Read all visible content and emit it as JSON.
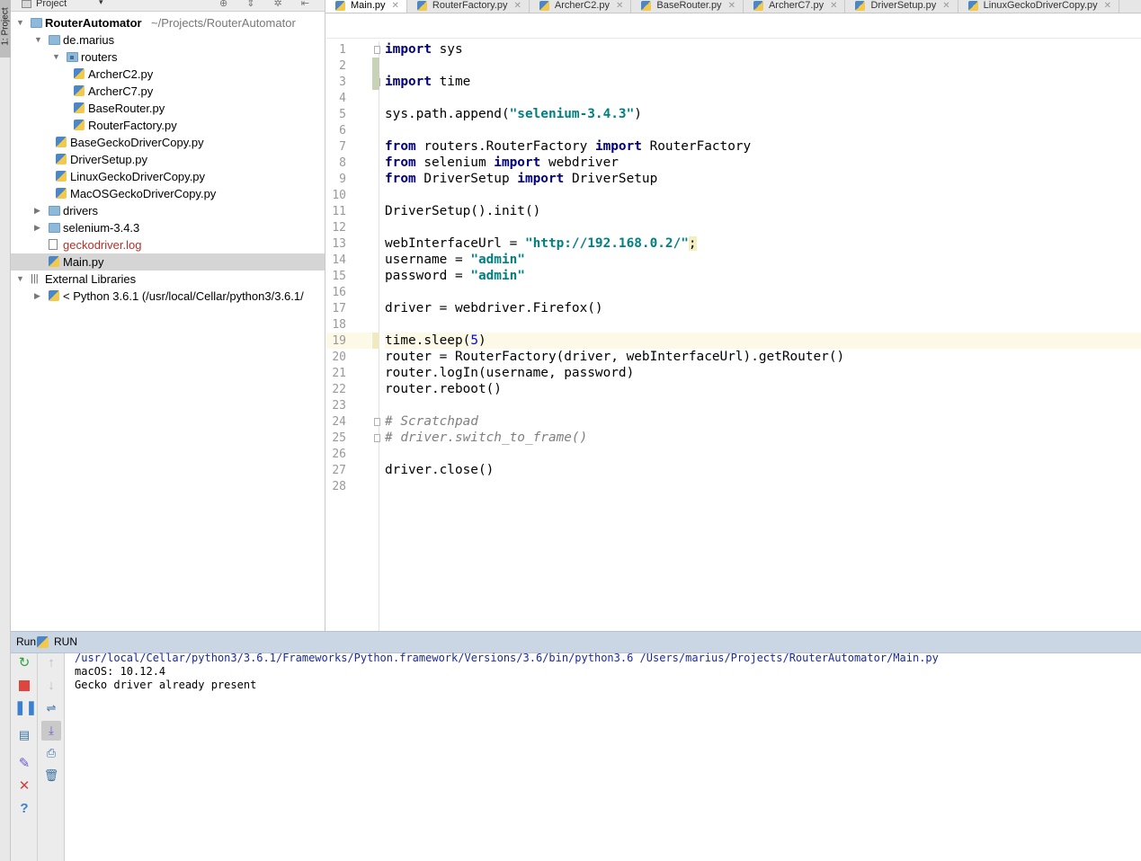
{
  "sidebar": {
    "strip_tab": "1: Project",
    "panel_title": "Project",
    "panel_dropdown": "▾",
    "tools": "⊕ ⇕ ✲ ⇤"
  },
  "tree": [
    {
      "label": "RouterAutomator",
      "path": "~/Projects/RouterAutomator",
      "depth": 0,
      "type": "root",
      "expanded": true
    },
    {
      "label": "de.marius",
      "depth": 1,
      "type": "folder",
      "expanded": true
    },
    {
      "label": "routers",
      "depth": 2,
      "type": "package",
      "expanded": true
    },
    {
      "label": "ArcherC2.py",
      "depth": 3,
      "type": "py"
    },
    {
      "label": "ArcherC7.py",
      "depth": 3,
      "type": "py"
    },
    {
      "label": "BaseRouter.py",
      "depth": 3,
      "type": "py"
    },
    {
      "label": "RouterFactory.py",
      "depth": 3,
      "type": "py"
    },
    {
      "label": "BaseGeckoDriverCopy.py",
      "depth": 2,
      "type": "py"
    },
    {
      "label": "DriverSetup.py",
      "depth": 2,
      "type": "py"
    },
    {
      "label": "LinuxGeckoDriverCopy.py",
      "depth": 2,
      "type": "py"
    },
    {
      "label": "MacOSGeckoDriverCopy.py",
      "depth": 2,
      "type": "py"
    },
    {
      "label": "drivers",
      "depth": 1,
      "type": "folder",
      "expanded": false
    },
    {
      "label": "selenium-3.4.3",
      "depth": 1,
      "type": "folder",
      "expanded": false
    },
    {
      "label": "geckodriver.log",
      "depth": 1,
      "type": "log"
    },
    {
      "label": "Main.py",
      "depth": 1,
      "type": "py",
      "selected": true
    },
    {
      "label": "External Libraries",
      "depth": 0,
      "type": "lib",
      "expanded": true
    },
    {
      "label": "< Python 3.6.1 (/usr/local/Cellar/python3/3.6.1/",
      "depth": 1,
      "type": "pyenv",
      "expanded": false
    }
  ],
  "editor_tabs": [
    {
      "label": "Main.py",
      "active": true
    },
    {
      "label": "RouterFactory.py"
    },
    {
      "label": "ArcherC2.py"
    },
    {
      "label": "BaseRouter.py"
    },
    {
      "label": "ArcherC7.py"
    },
    {
      "label": "DriverSetup.py"
    },
    {
      "label": "LinuxGeckoDriverCopy.py"
    }
  ],
  "editor": {
    "current_line": 19,
    "lines": [
      [
        [
          "kw",
          "import"
        ],
        [
          "t",
          " sys"
        ]
      ],
      [],
      [
        [
          "kw",
          "import"
        ],
        [
          "t",
          " time"
        ]
      ],
      [],
      [
        [
          "t",
          "sys.path.append("
        ],
        [
          "str",
          "\"selenium-3.4.3\""
        ],
        [
          "t",
          ")"
        ]
      ],
      [],
      [
        [
          "kw",
          "from"
        ],
        [
          "t",
          " routers.RouterFactory "
        ],
        [
          "kw",
          "import"
        ],
        [
          "t",
          " RouterFactory"
        ]
      ],
      [
        [
          "kw",
          "from"
        ],
        [
          "t",
          " selenium "
        ],
        [
          "kw",
          "import"
        ],
        [
          "t",
          " webdriver"
        ]
      ],
      [
        [
          "kw",
          "from"
        ],
        [
          "t",
          " DriverSetup "
        ],
        [
          "kw",
          "import"
        ],
        [
          "t",
          " DriverSetup"
        ]
      ],
      [],
      [
        [
          "t",
          "DriverSetup().init()"
        ]
      ],
      [],
      [
        [
          "t",
          "webInterfaceUrl = "
        ],
        [
          "str",
          "\"http://192.168.0.2/\""
        ],
        [
          "semi",
          ";"
        ]
      ],
      [
        [
          "t",
          "username = "
        ],
        [
          "str",
          "\"admin\""
        ]
      ],
      [
        [
          "t",
          "password = "
        ],
        [
          "str",
          "\"admin\""
        ]
      ],
      [],
      [
        [
          "t",
          "driver = webdriver.Firefox()"
        ]
      ],
      [],
      [
        [
          "t",
          "time.sleep("
        ],
        [
          "num",
          "5"
        ],
        [
          "t",
          ")"
        ]
      ],
      [
        [
          "t",
          "router = RouterFactory(driver, webInterfaceUrl).getRouter()"
        ]
      ],
      [
        [
          "t",
          "router.logIn(username, password)"
        ]
      ],
      [
        [
          "t",
          "router.reboot()"
        ]
      ],
      [],
      [
        [
          "cmt",
          "# Scratchpad"
        ]
      ],
      [
        [
          "cmt",
          "# driver.switch_to_frame()"
        ]
      ],
      [],
      [
        [
          "t",
          "driver.close()"
        ]
      ],
      []
    ]
  },
  "run_panel": {
    "label": "Run",
    "config_name": "RUN",
    "console": [
      {
        "text": "/usr/local/Cellar/python3/3.6.1/Frameworks/Python.framework/Versions/3.6/bin/python3.6 /Users/marius/Projects/RouterAutomator/Main.py",
        "kind": "cmd"
      },
      {
        "text": "macOS: 10.12.4",
        "kind": "out"
      },
      {
        "text": "Gecko driver already present",
        "kind": "out"
      }
    ]
  },
  "colors": {
    "keyword": "#000080",
    "string": "#008080",
    "number": "#0000ff",
    "comment": "#808080",
    "log_file": "#b0322a",
    "console_cmd": "#1a2a9c"
  }
}
